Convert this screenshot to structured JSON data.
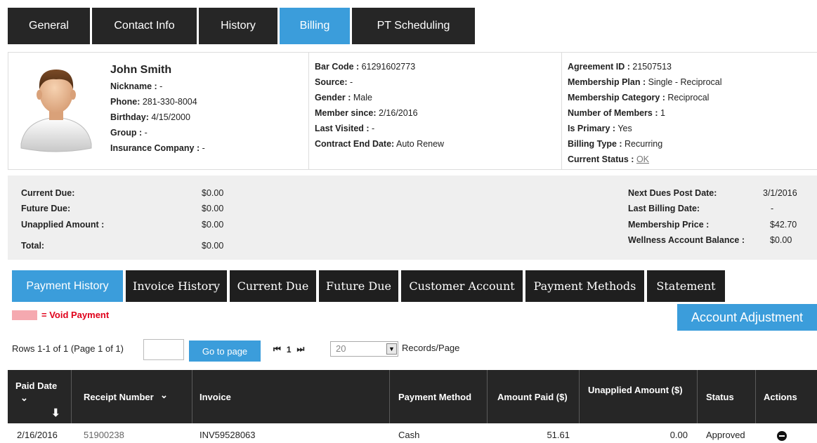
{
  "top_tabs": [
    "General",
    "Contact Info",
    "History",
    "Billing",
    "PT Scheduling"
  ],
  "member": {
    "name": "John Smith",
    "nickname_label": "Nickname :",
    "nickname": " -",
    "phone_label": "Phone:",
    "phone": " 281-330-8004",
    "birthday_label": "Birthday:",
    "birthday": " 4/15/2000",
    "group_label": "Group :",
    "group": " -",
    "insurance_label": "Insurance Company :",
    "insurance": " -",
    "barcode_label": "Bar Code :",
    "barcode": " 61291602773",
    "source_label": "Source:",
    "source": " -",
    "gender_label": "Gender :",
    "gender": " Male",
    "member_since_label": "Member since:",
    "member_since": " 2/16/2016",
    "last_visited_label": "Last Visited :",
    "last_visited": " -",
    "contract_end_label": "Contract End Date:",
    "contract_end": " Auto Renew",
    "agreement_label": "Agreement ID :",
    "agreement": " 21507513",
    "plan_label": "Membership Plan :",
    "plan": " Single - Reciprocal",
    "category_label": "Membership Category :",
    "category": " Reciprocal",
    "num_members_label": "Number of Members :",
    "num_members": " 1",
    "is_primary_label": "Is Primary :",
    "is_primary": " Yes",
    "billing_type_label": "Billing Type :",
    "billing_type": " Recurring",
    "current_status_label": "Current Status :",
    "current_status": "OK"
  },
  "summary": {
    "current_due_label": "Current Due:",
    "current_due": "$0.00",
    "future_due_label": "Future Due:",
    "future_due": "$0.00",
    "unapplied_label": "Unapplied Amount :",
    "unapplied": "$0.00",
    "total_label": "Total:",
    "total": "$0.00",
    "next_post_label": "Next Dues Post Date:",
    "next_post": "3/1/2016",
    "last_billing_label": "Last Billing Date:",
    "last_billing": "-",
    "price_label": "Membership Price :",
    "price": "$42.70",
    "wellness_label": "Wellness Account Balance :",
    "wellness": "$0.00"
  },
  "sub_tabs": [
    "Payment History",
    "Invoice History",
    "Current Due",
    "Future Due",
    "Customer Account",
    "Payment Methods",
    "Statement"
  ],
  "void_legend": "= Void Payment",
  "adjust_button": "Account Adjustment",
  "pager": {
    "rows_info": "Rows 1-1 of 1 (Page 1 of 1)",
    "page_input": "",
    "goto_label": "Go to page",
    "first": "⏮",
    "page": "1",
    "last": "⏭",
    "records_value": "20",
    "records_label": "Records/Page"
  },
  "table": {
    "columns": [
      "Paid Date",
      "Receipt Number",
      "Invoice",
      "Payment Method",
      "Amount Paid ($)",
      "Unapplied Amount ($)",
      "Status",
      "Actions"
    ],
    "rows": [
      {
        "paid_date": "2/16/2016",
        "receipt": "51900238",
        "invoice": "INV59528063",
        "method": "Cash",
        "amount": "51.61",
        "unapplied": "0.00",
        "status": "Approved"
      }
    ]
  },
  "colors": {
    "accent": "#3b9ddb",
    "dark": "#262626",
    "void": "#f5a9b0",
    "void_text": "#e0001a"
  }
}
